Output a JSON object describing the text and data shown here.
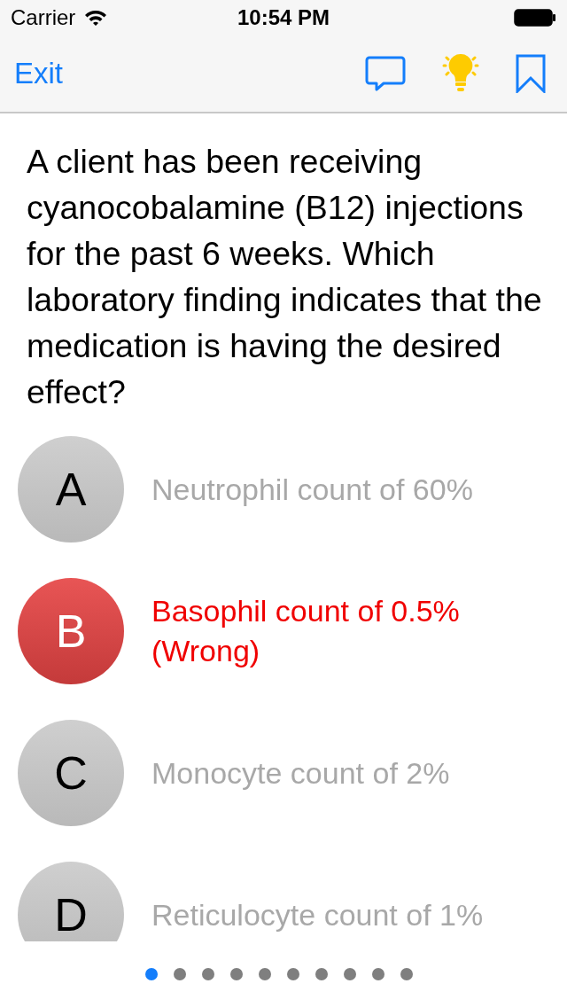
{
  "status_bar": {
    "carrier": "Carrier",
    "time": "10:54 PM"
  },
  "nav": {
    "exit": "Exit",
    "hint_on": true
  },
  "question": "A client has been receiving cyanocobalamine (B12) injections for the past 6 weeks. Which laboratory finding indicates that the medication is having the desired effect?",
  "options": [
    {
      "letter": "A",
      "text": "Neutrophil count of 60%",
      "wrong": false
    },
    {
      "letter": "B",
      "text": "Basophil count of 0.5%",
      "note": "(Wrong)",
      "wrong": true
    },
    {
      "letter": "C",
      "text": "Monocyte count of 2%",
      "wrong": false
    },
    {
      "letter": "D",
      "text": "Reticulocyte count of 1%",
      "wrong": false
    }
  ],
  "pages": [
    {
      "selected": true
    },
    {
      "selected": false
    },
    {
      "selected": false
    },
    {
      "selected": false
    },
    {
      "selected": false
    },
    {
      "selected": false
    },
    {
      "selected": false
    },
    {
      "selected": false
    },
    {
      "selected": false
    },
    {
      "selected": false
    }
  ]
}
